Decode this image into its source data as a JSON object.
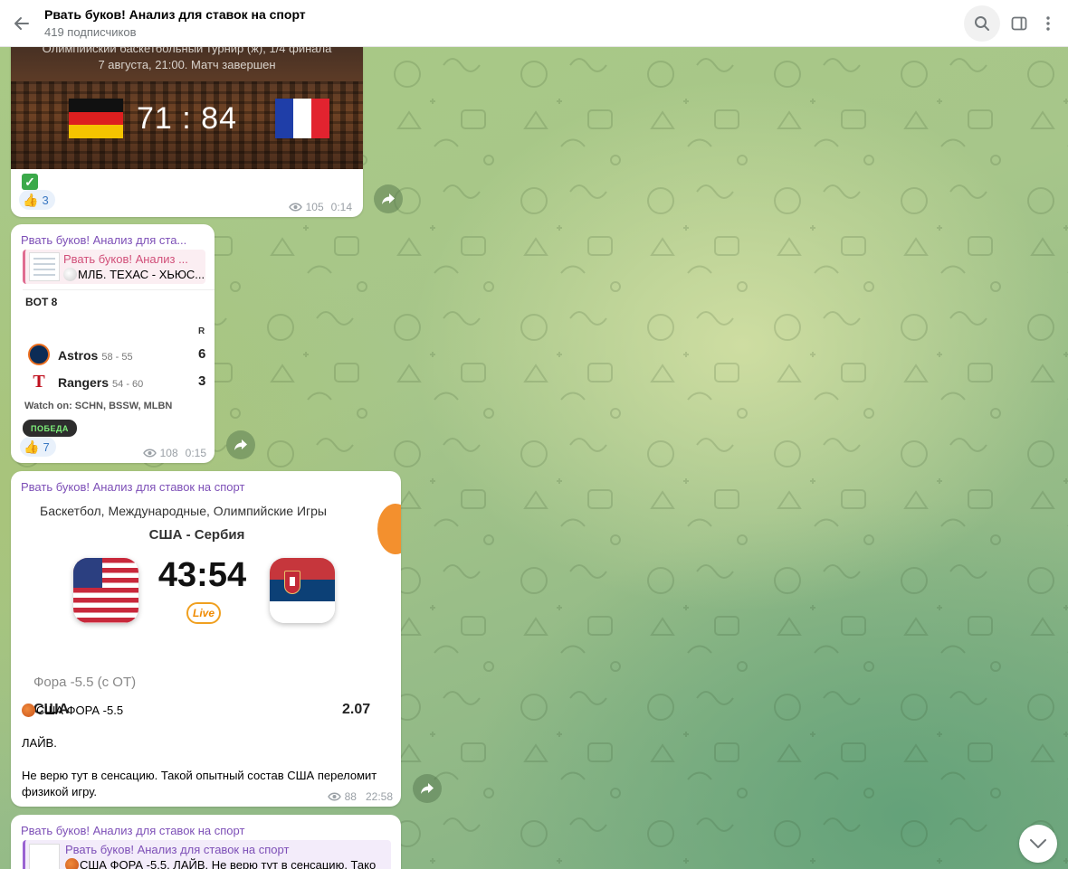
{
  "header": {
    "title": "Рвать буков! Анализ для ставок на спорт",
    "subscribers": "419 подписчиков",
    "icons": [
      "back-arrow-icon",
      "search-icon",
      "side-panel-icon",
      "more-vertical-icon"
    ]
  },
  "messages": [
    {
      "card": {
        "tournament": "Олимпийский баскетбольный турнир (ж), 1/4 финала",
        "date": "7 августа, 21:00. Матч завершен",
        "score": "71 : 84",
        "home_flag": "germany",
        "away_flag": "france"
      },
      "status_icon": "check-mark-icon",
      "reaction": {
        "emoji": "👍",
        "count": "3"
      },
      "views": "105",
      "time": "0:14"
    },
    {
      "sender": "Рвать буков! Анализ для ста...",
      "forward": {
        "title": "Рвать буков! Анализ ...",
        "text": "МЛБ. ТЕХАС - ХЬЮС..."
      },
      "scoreboard": {
        "inning": "BOT 8",
        "runs_header": "R",
        "teams": [
          {
            "name": "Astros",
            "record": "58 - 55",
            "runs": "6"
          },
          {
            "name": "Rangers",
            "record": "54 - 60",
            "runs": "3"
          }
        ],
        "watch": "Watch on: SCHN, BSSW, MLBN"
      },
      "badge": "ПОБЕДА",
      "reaction": {
        "emoji": "👍",
        "count": "7"
      },
      "views": "108",
      "time": "0:15"
    },
    {
      "sender": "Рвать буков! Анализ для ставок на спорт",
      "bet_card": {
        "competition": "Баскетбол, Международные, Олимпийские Игры",
        "match": "США - Сербия",
        "score": "43:54",
        "live": "Live",
        "market": "Фора -5.5 (с ОТ)",
        "pick": "США",
        "odds": "2.07"
      },
      "lines": [
        "США ФОРА -5.5",
        "ЛАЙВ.",
        "Не верю тут в сенсацию. Такой опытный состав США переломит",
        "физикой игру."
      ],
      "views": "88",
      "time": "22:58"
    },
    {
      "sender": "Рвать буков! Анализ для ставок на спорт",
      "forward": {
        "title": "Рвать буков! Анализ для ставок на спорт",
        "text": "США ФОРА -5.5. ЛАЙВ.  Не верю тут в сенсацию. Тако"
      }
    }
  ],
  "colors": {
    "sender": "#7d4fb7",
    "forward_accent": "#e06d91",
    "reaction_bg": "#e9f1fb",
    "reaction_text": "#3a78c2",
    "win_badge_text": "#7ef07a"
  }
}
